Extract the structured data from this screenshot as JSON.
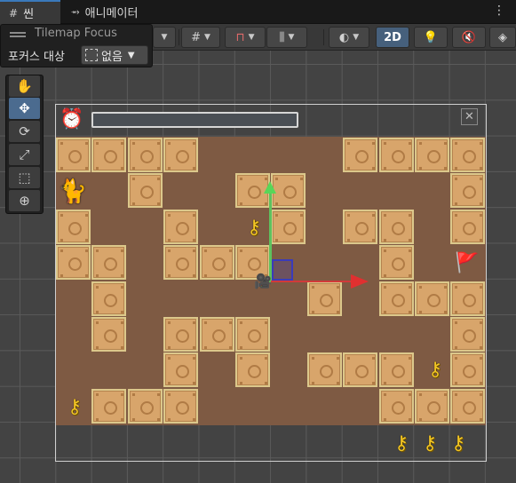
{
  "tabs": [
    {
      "icon": "#",
      "label": "씬"
    },
    {
      "icon": "⥇",
      "label": "애니메이터"
    }
  ],
  "toolbar": {
    "mode_2d_label": "2D"
  },
  "tilemap_focus": {
    "title": "Tilemap Focus",
    "focus_target_label": "포커스 대상",
    "focus_target_value": "없음"
  },
  "tools": [
    "hand-tool",
    "move-tool",
    "rotate-tool",
    "scale-tool",
    "rect-tool",
    "transform-tool"
  ],
  "colors": {
    "ground": "#7e5a43",
    "tile": "#d8a56b",
    "gizmo_x": "#d13a3a",
    "gizmo_y": "#5ec15e",
    "accent_2d": "#46607c"
  }
}
